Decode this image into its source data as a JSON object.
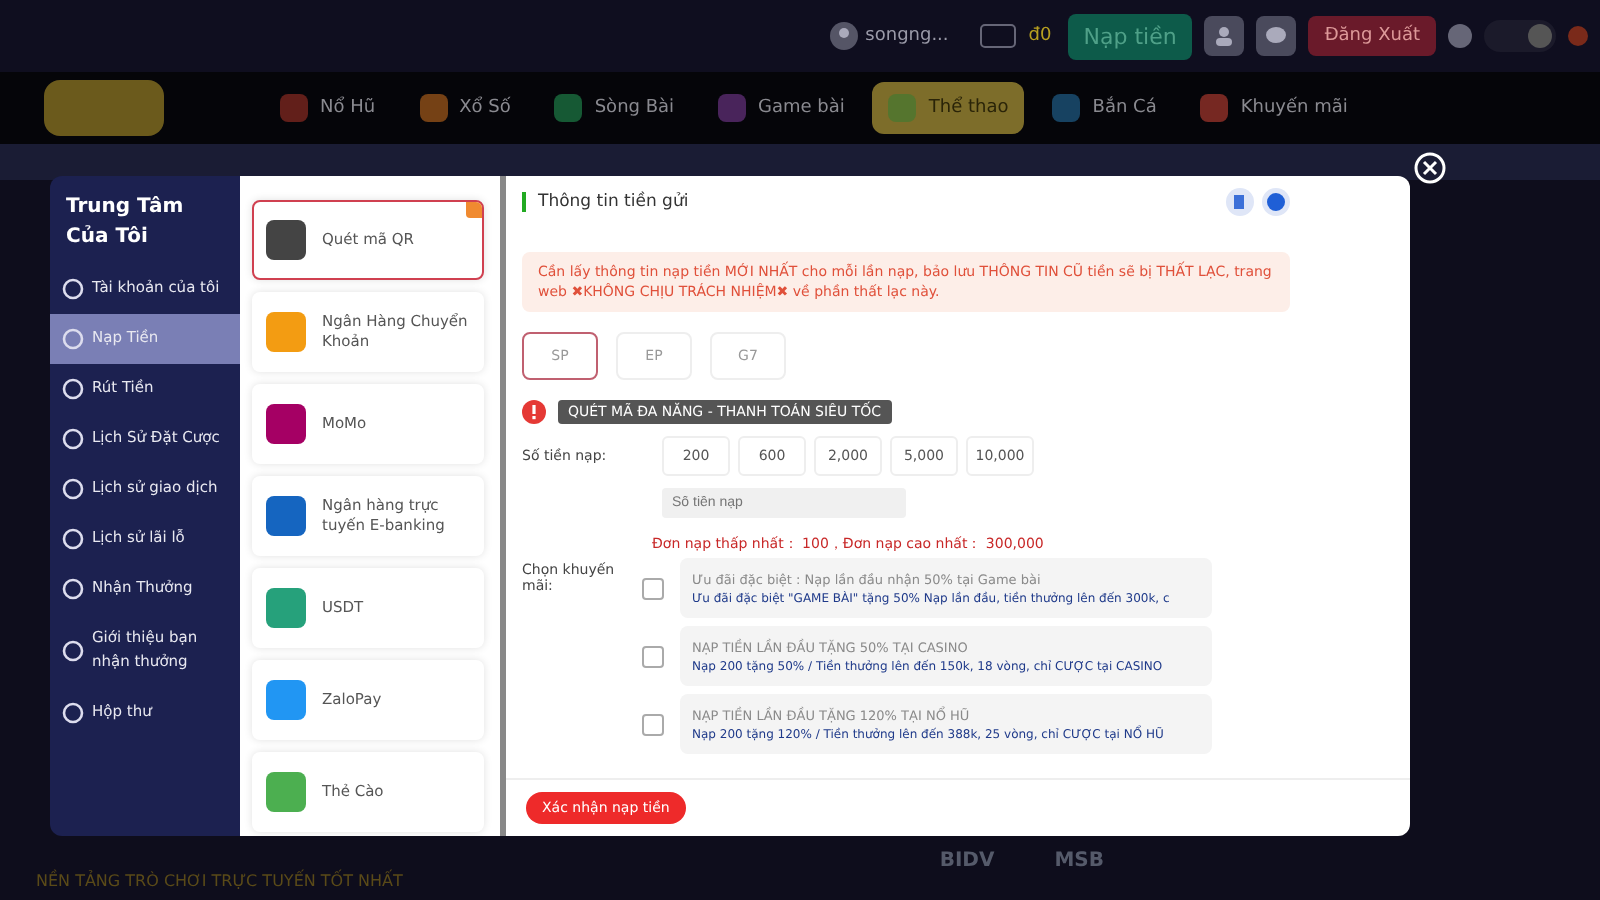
{
  "top_bar": {
    "username": "songng...",
    "balance": "đ0",
    "deposit_button": "Nạp tiền",
    "logout_button": "Đăng Xuất",
    "theme_toggle": {
      "on": true
    }
  },
  "nav": [
    {
      "label": "Nổ Hũ",
      "selected": false
    },
    {
      "label": "Xổ Số",
      "selected": false
    },
    {
      "label": "Sòng Bài",
      "selected": false
    },
    {
      "label": "Game bài",
      "selected": false
    },
    {
      "label": "Thể thao",
      "selected": true
    },
    {
      "label": "Bắn Cá",
      "selected": false
    },
    {
      "label": "Khuyến mãi",
      "selected": false
    }
  ],
  "sidebar": {
    "title": "Trung Tâm Của Tôi",
    "items": [
      {
        "label": "Tài khoản của tôi",
        "selected": false
      },
      {
        "label": "Nạp Tiền",
        "selected": true
      },
      {
        "label": "Rút Tiền",
        "selected": false
      },
      {
        "label": "Lịch Sử Đặt Cược",
        "selected": false
      },
      {
        "label": "Lịch sử giao dịch",
        "selected": false
      },
      {
        "label": "Lịch sử lãi lỗ",
        "selected": false
      },
      {
        "label": "Nhận Thưởng",
        "selected": false
      },
      {
        "label": "Giới thiệu bạn nhận thưởng",
        "selected": false
      },
      {
        "label": "Hộp thư",
        "selected": false
      }
    ]
  },
  "methods": [
    {
      "label": "Quét mã QR",
      "selected": true
    },
    {
      "label": "Ngân Hàng Chuyển Khoản",
      "selected": false
    },
    {
      "label": "MoMo",
      "selected": false
    },
    {
      "label": "Ngân hàng trực tuyến E-banking",
      "selected": false
    },
    {
      "label": "USDT",
      "selected": false
    },
    {
      "label": "ZaloPay",
      "selected": false
    },
    {
      "label": "Thẻ Cào",
      "selected": false
    }
  ],
  "panel": {
    "title": "Thông tin tiền gửi",
    "warning": "Cần lấy thông tin nạp tiền MỚI NHẤT cho mỗi lần nạp, bảo lưu THÔNG TIN CŨ tiền sẽ bị THẤT LẠC, trang web ✖KHÔNG CHỊU TRÁCH NHIỆM✖ về phần thất lạc này.",
    "channels": [
      {
        "label": "SP",
        "selected": true
      },
      {
        "label": "EP",
        "selected": false
      },
      {
        "label": "G7",
        "selected": false
      }
    ],
    "notice": "QUÉT MÃ ĐA NĂNG - THANH TOÁN SIÊU TỐC",
    "amount_label": "Số tiền nạp:",
    "amounts": [
      "200",
      "600",
      "2,000",
      "5,000",
      "10,000"
    ],
    "amount_field": {
      "placeholder": "Số tiền nạp"
    },
    "limits": "Đơn nạp thấp nhất： 100，Đơn nạp cao nhất： 300,000",
    "promo_label": "Chọn khuyến mãi:",
    "promos": [
      {
        "title": "Ưu đãi đặc biệt : Nạp lần đầu nhận 50% tại Game bài",
        "description": "Ưu đãi đặc biệt \"GAME BÀI\" tặng 50% Nạp lần đầu, tiền thưởng lên đến 300k, c",
        "checked": false
      },
      {
        "title": "NẠP TIỀN LẦN ĐẦU TẶNG 50% TẠI CASINO",
        "description": "Nạp 200 tặng 50% / Tiền thưởng lên đến 150k, 18 vòng, chỉ CƯỢC tại CASINO",
        "checked": false
      },
      {
        "title": "NẠP TIỀN LẦN ĐẦU TẶNG 120% TẠI NỔ HŨ",
        "description": "Nạp 200 tặng 120% / Tiền thưởng lên đến 388k, 25 vòng, chỉ CƯỢC tại NỔ HŨ",
        "checked": false
      }
    ],
    "submit": "Xác nhận nạp tiền"
  },
  "footer": {
    "tagline": "NỀN TẢNG TRÒ CHƠI TRỰC TUYẾN TỐT NHẤT",
    "banks": [
      "BIDV",
      "MSB"
    ]
  }
}
